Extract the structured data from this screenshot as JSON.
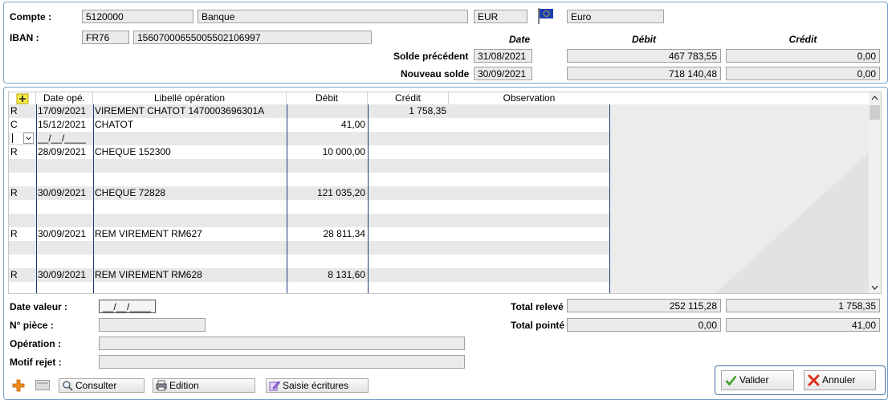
{
  "account": {
    "compte_label": "Compte :",
    "compte_number": "5120000",
    "compte_name": "Banque",
    "currency_code": "EUR",
    "currency_name": "Euro",
    "iban_label": "IBAN :",
    "iban_country": "FR76",
    "iban_number": "15607000655005502106997"
  },
  "balances": {
    "col_date": "Date",
    "col_debit": "Débit",
    "col_credit": "Crédit",
    "previous_label": "Solde précédent",
    "previous_date": "31/08/2021",
    "previous_debit": "467 783,55",
    "previous_credit": "0,00",
    "new_label": "Nouveau solde",
    "new_date": "30/09/2021",
    "new_debit": "718 140,48",
    "new_credit": "0,00"
  },
  "grid": {
    "headers": [
      "Date opé.",
      "Libellé opération",
      "Débit",
      "Crédit",
      "Observation"
    ],
    "rows": [
      {
        "type": "R",
        "date": "17/09/2021",
        "label": "VIREMENT CHATOT 1470003696301A",
        "debit": "",
        "credit": "1 758,35",
        "obs": ""
      },
      {
        "type": "C",
        "date": "15/12/2021",
        "label": "CHATOT",
        "debit": "41,00",
        "credit": "",
        "obs": ""
      },
      {
        "type": "",
        "date": "__/__/____",
        "label": "",
        "debit": "",
        "credit": "",
        "obs": ""
      },
      {
        "type": "R",
        "date": "28/09/2021",
        "label": "CHEQUE 152300",
        "debit": "10 000,00",
        "credit": "",
        "obs": ""
      },
      {
        "type": "",
        "date": "",
        "label": "",
        "debit": "",
        "credit": "",
        "obs": ""
      },
      {
        "type": "",
        "date": "",
        "label": "",
        "debit": "",
        "credit": "",
        "obs": ""
      },
      {
        "type": "R",
        "date": "30/09/2021",
        "label": "CHEQUE 72828",
        "debit": "121 035,20",
        "credit": "",
        "obs": ""
      },
      {
        "type": "",
        "date": "",
        "label": "",
        "debit": "",
        "credit": "",
        "obs": ""
      },
      {
        "type": "",
        "date": "",
        "label": "",
        "debit": "",
        "credit": "",
        "obs": ""
      },
      {
        "type": "R",
        "date": "30/09/2021",
        "label": "REM VIREMENT RM627",
        "debit": "28 811,34",
        "credit": "",
        "obs": ""
      },
      {
        "type": "",
        "date": "",
        "label": "",
        "debit": "",
        "credit": "",
        "obs": ""
      },
      {
        "type": "",
        "date": "",
        "label": "",
        "debit": "",
        "credit": "",
        "obs": ""
      },
      {
        "type": "R",
        "date": "30/09/2021",
        "label": "REM VIREMENT RM628",
        "debit": "8 131,60",
        "credit": "",
        "obs": ""
      },
      {
        "type": "",
        "date": "",
        "label": "",
        "debit": "",
        "credit": "",
        "obs": ""
      }
    ]
  },
  "details": {
    "date_valeur_label": "Date valeur :",
    "date_valeur_value": "__/__/____",
    "piece_label": "N° pièce :",
    "operation_label": "Opération :",
    "motif_label": "Motif rejet :"
  },
  "totals": {
    "releve_label": "Total relevé",
    "releve_debit": "252 115,28",
    "releve_credit": "1 758,35",
    "pointe_label": "Total pointé",
    "pointe_debit": "0,00",
    "pointe_credit": "41,00"
  },
  "toolbar": {
    "consulter": "Consulter",
    "edition": "Edition",
    "saisie": "Saisie écritures",
    "valider": "Valider",
    "annuler": "Annuler"
  },
  "colors": {
    "panel_border": "#7ba3c8",
    "column_line": "#1f3a7a",
    "alt_row": "#e8e8e8"
  }
}
